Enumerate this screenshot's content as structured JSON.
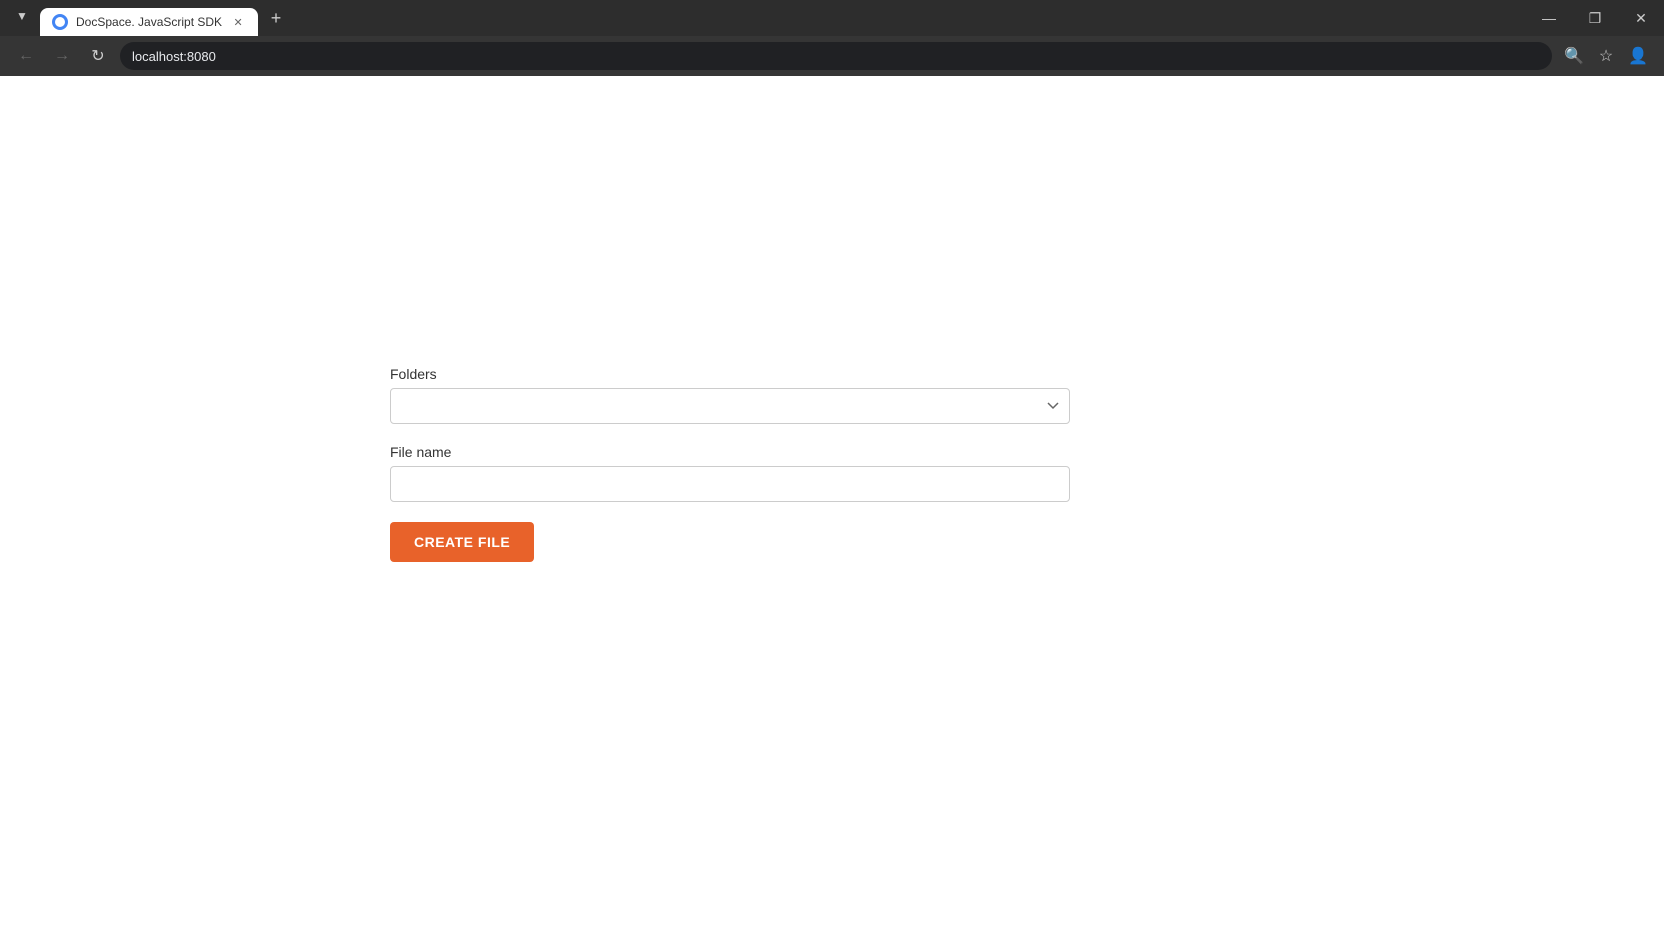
{
  "browser": {
    "tab": {
      "title": "DocSpace. JavaScript SDK",
      "favicon": "docspace-favicon"
    },
    "address": "localhost:8080",
    "new_tab_label": "+",
    "window_controls": {
      "minimize": "—",
      "maximize": "❐",
      "close": "✕"
    },
    "nav": {
      "back": "←",
      "forward": "→",
      "refresh": "↻"
    },
    "toolbar_icons": {
      "zoom": "🔍",
      "bookmark": "☆",
      "profile": "👤"
    }
  },
  "form": {
    "folders_label": "Folders",
    "folders_placeholder": "",
    "folders_options": [],
    "filename_label": "File name",
    "filename_placeholder": "",
    "submit_button": "CREATE FILE"
  },
  "colors": {
    "submit_button_bg": "#e8622a",
    "submit_button_text": "#ffffff"
  }
}
